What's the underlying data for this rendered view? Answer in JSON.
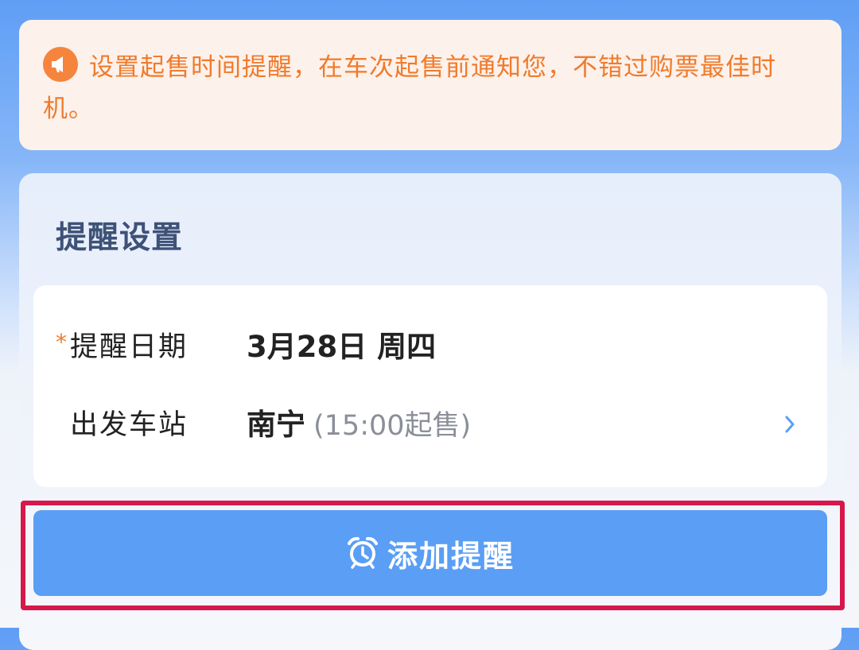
{
  "notice": {
    "icon": "megaphone-icon",
    "text": "设置起售时间提醒，在车次起售前通知您，不错过购票最佳时机。"
  },
  "settings": {
    "title": "提醒设置",
    "date_row": {
      "required_mark": "*",
      "label": "提醒日期",
      "value": "3月28日 周四"
    },
    "station_row": {
      "label": "出发车站",
      "value": "南宁",
      "sale_time": "(15:00起售)",
      "icon": "chevron-right-icon"
    }
  },
  "add_button": {
    "icon": "alarm-clock-icon",
    "label": "添加提醒"
  },
  "colors": {
    "accent": "#5a9ef5",
    "notice_text": "#f07b2c",
    "notice_bg": "#fdf1eb",
    "focus_frame": "#d6174a"
  }
}
